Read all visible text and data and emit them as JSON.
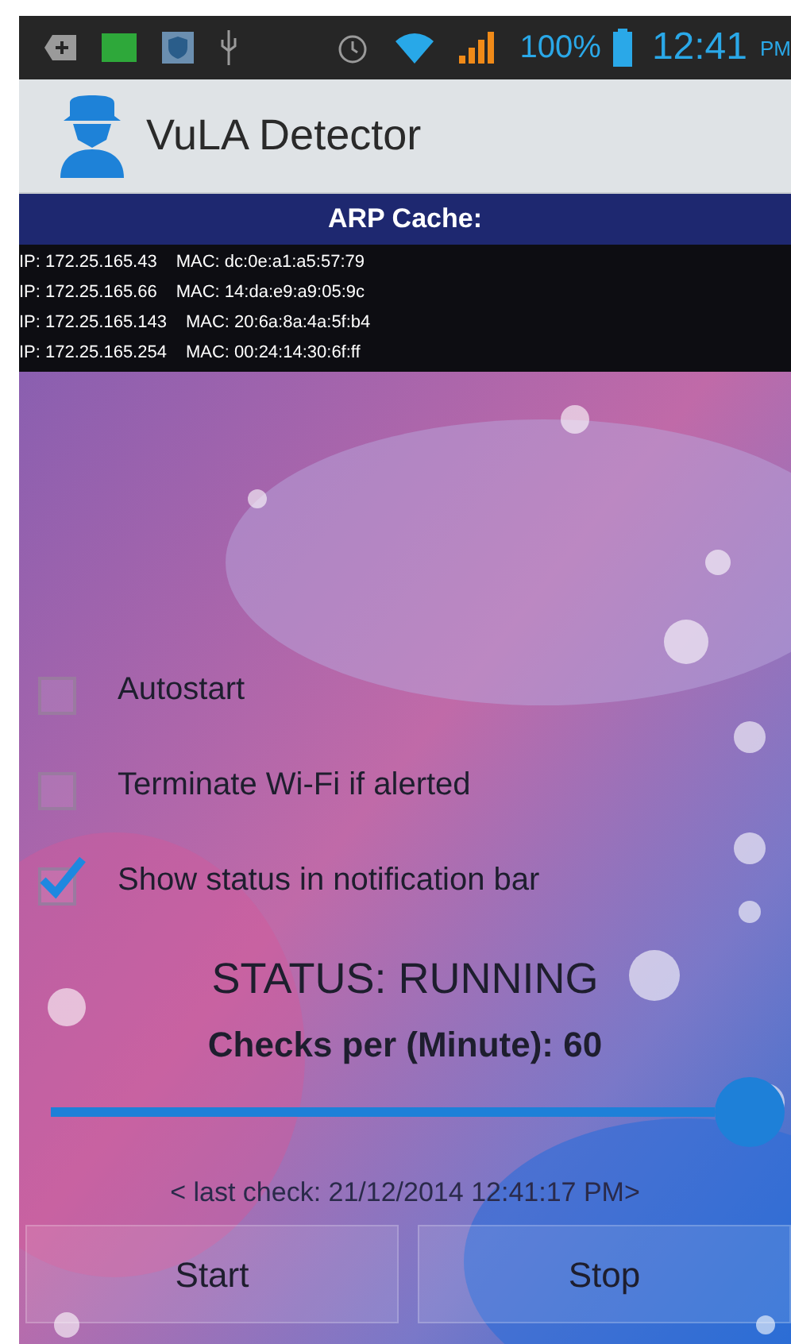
{
  "status_bar": {
    "battery": "100%",
    "time": "12:41",
    "ampm": "PM"
  },
  "app_bar": {
    "title": "VuLA Detector"
  },
  "arp_cache": {
    "title": "ARP Cache:",
    "entries": [
      {
        "ip": "IP: 172.25.165.43",
        "mac": "MAC: dc:0e:a1:a5:57:79"
      },
      {
        "ip": "IP: 172.25.165.66",
        "mac": "MAC: 14:da:e9:a9:05:9c"
      },
      {
        "ip": "IP: 172.25.165.143",
        "mac": "MAC: 20:6a:8a:4a:5f:b4"
      },
      {
        "ip": "IP: 172.25.165.254",
        "mac": "MAC: 00:24:14:30:6f:ff"
      }
    ]
  },
  "options": [
    {
      "label": "Autostart",
      "checked": false
    },
    {
      "label": "Terminate Wi-Fi if alerted",
      "checked": false
    },
    {
      "label": "Show status in notification bar",
      "checked": true
    }
  ],
  "status": "STATUS: RUNNING",
  "checks_label": "Checks per (Minute): 60",
  "slider": {
    "level": 1
  },
  "last_check": "< last check: 21/12/2014 12:41:17 PM>",
  "buttons": [
    "Start",
    "Stop"
  ]
}
